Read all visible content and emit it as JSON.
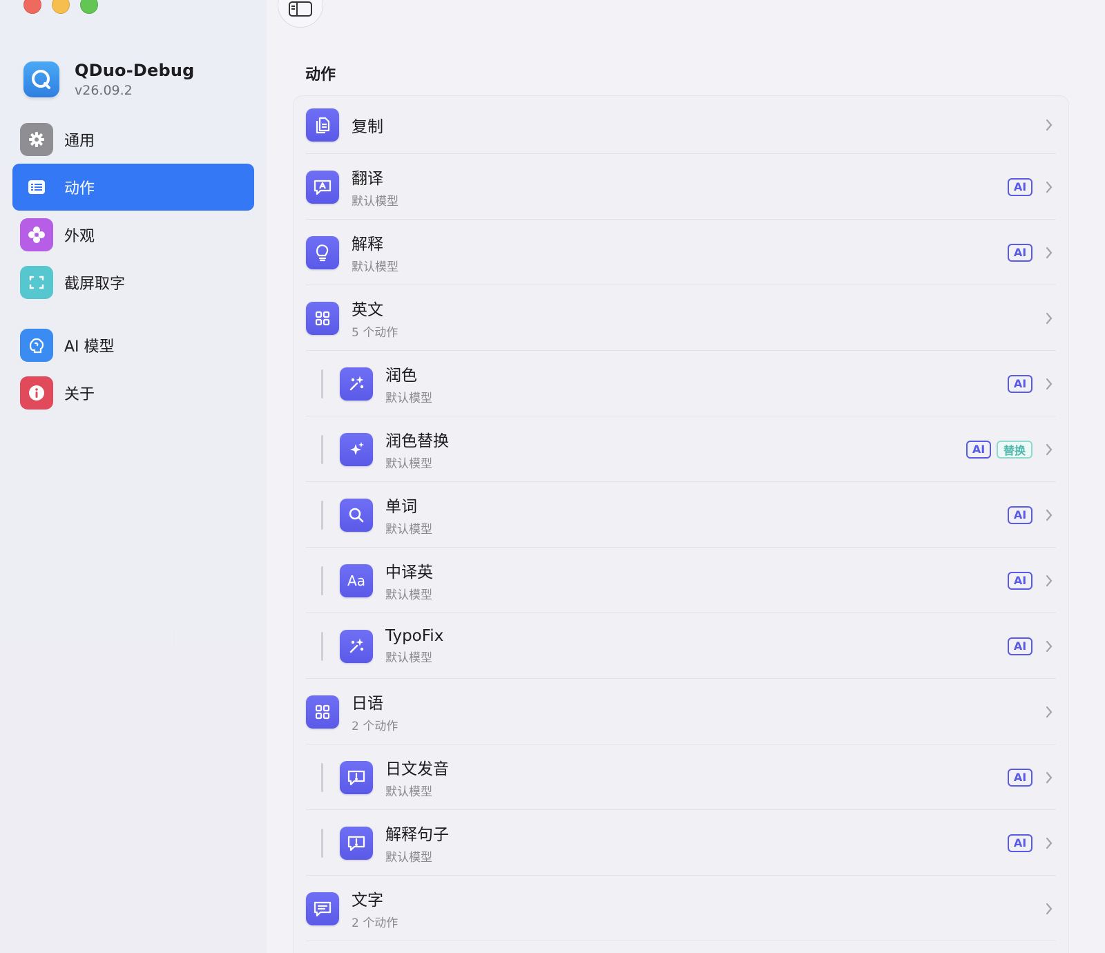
{
  "app": {
    "name": "QDuo-Debug",
    "version": "v26.09.2"
  },
  "sidebar": {
    "items": [
      {
        "label": "通用",
        "icon": "gear-icon",
        "color": "#8e8e93"
      },
      {
        "label": "动作",
        "icon": "list-icon",
        "color": "#3478f6",
        "active": true
      },
      {
        "label": "外观",
        "icon": "flower-icon",
        "color": "#b65fe6"
      },
      {
        "label": "截屏取字",
        "icon": "capture-icon",
        "color": "#56c6cf"
      },
      {
        "label": "AI 模型",
        "icon": "brain-icon",
        "color": "#3b8cf2"
      },
      {
        "label": "关于",
        "icon": "info-icon",
        "color": "#e04a5a"
      }
    ]
  },
  "main": {
    "title": "动作",
    "rows": [
      {
        "title": "复制",
        "subtitle": "",
        "icon": "copy-icon",
        "badges": []
      },
      {
        "title": "翻译",
        "subtitle": "默认模型",
        "icon": "translate-bubble-icon",
        "badges": [
          "AI"
        ]
      },
      {
        "title": "解释",
        "subtitle": "默认模型",
        "icon": "lightbulb-icon",
        "badges": [
          "AI"
        ]
      },
      {
        "title": "英文",
        "subtitle": "5 个动作",
        "icon": "grid-icon",
        "badges": []
      },
      {
        "title": "润色",
        "subtitle": "默认模型",
        "icon": "magic-wand-icon",
        "badges": [
          "AI"
        ],
        "child": true
      },
      {
        "title": "润色替换",
        "subtitle": "默认模型",
        "icon": "sparkles-icon",
        "badges": [
          "AI",
          "替换"
        ],
        "child": true
      },
      {
        "title": "单词",
        "subtitle": "默认模型",
        "icon": "magnifier-icon",
        "badges": [
          "AI"
        ],
        "child": true
      },
      {
        "title": "中译英",
        "subtitle": "默认模型",
        "icon": "text-aa-icon",
        "badges": [
          "AI"
        ],
        "child": true
      },
      {
        "title": "TypoFix",
        "subtitle": "默认模型",
        "icon": "magic-wand-icon",
        "badges": [
          "AI"
        ],
        "child": true
      },
      {
        "title": "日语",
        "subtitle": "2 个动作",
        "icon": "grid-icon",
        "badges": []
      },
      {
        "title": "日文发音",
        "subtitle": "默认模型",
        "icon": "exclamation-bubble-icon",
        "badges": [
          "AI"
        ],
        "child": true
      },
      {
        "title": "解释句子",
        "subtitle": "默认模型",
        "icon": "exclamation-bubble-icon",
        "badges": [
          "AI"
        ],
        "child": true
      },
      {
        "title": "文字",
        "subtitle": "2 个动作",
        "icon": "text-bubble-icon",
        "badges": []
      }
    ]
  }
}
